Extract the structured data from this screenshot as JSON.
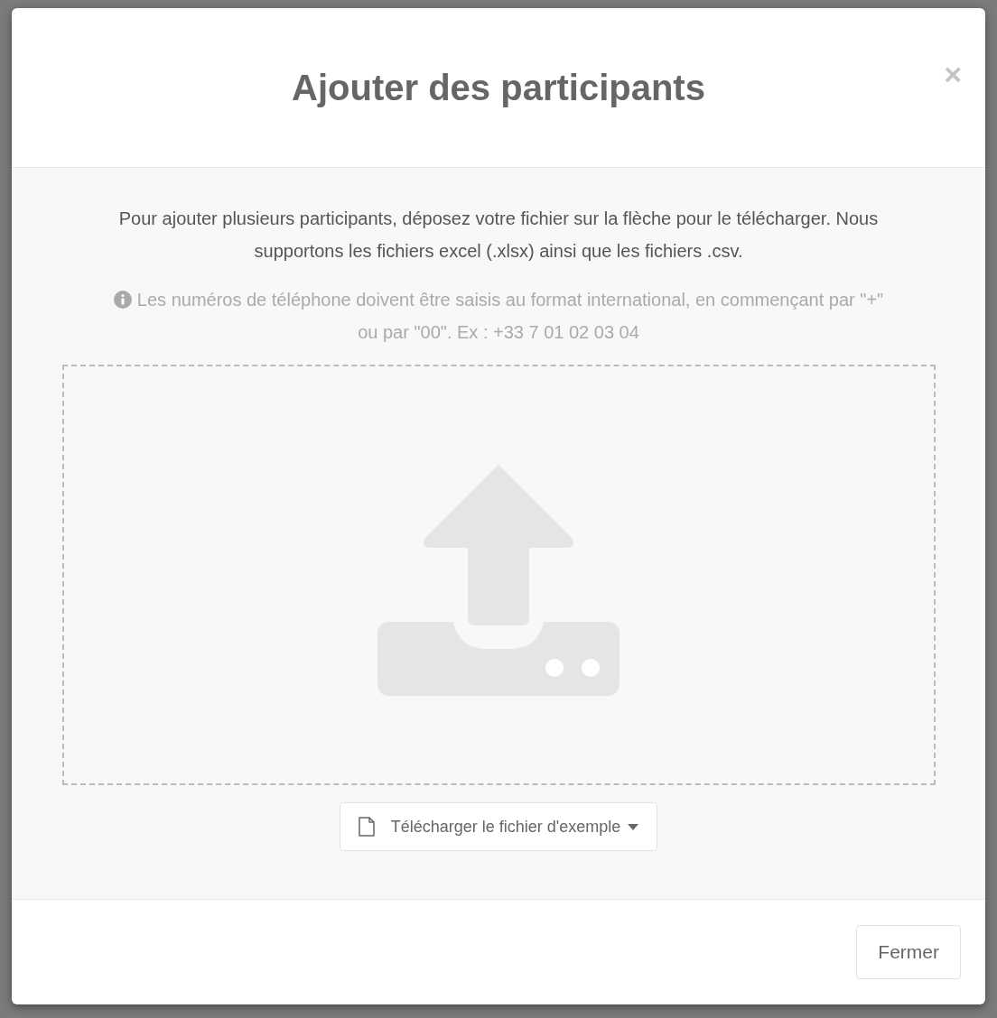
{
  "dialog": {
    "title": "Ajouter des participants",
    "close_label": "×",
    "intro": "Pour ajouter plusieurs participants, déposez votre fichier sur la flèche pour le télécharger. Nous supportons les fichiers excel (.xlsx) ainsi que les fichiers .csv.",
    "note": "Les numéros de téléphone doivent être saisis au format international, en commençant par \"+\" ou par \"00\". Ex : +33 7 01 02 03 04",
    "sample_button": "Télécharger le fichier d'exemple",
    "footer_buttons": [
      "Fermer"
    ]
  }
}
